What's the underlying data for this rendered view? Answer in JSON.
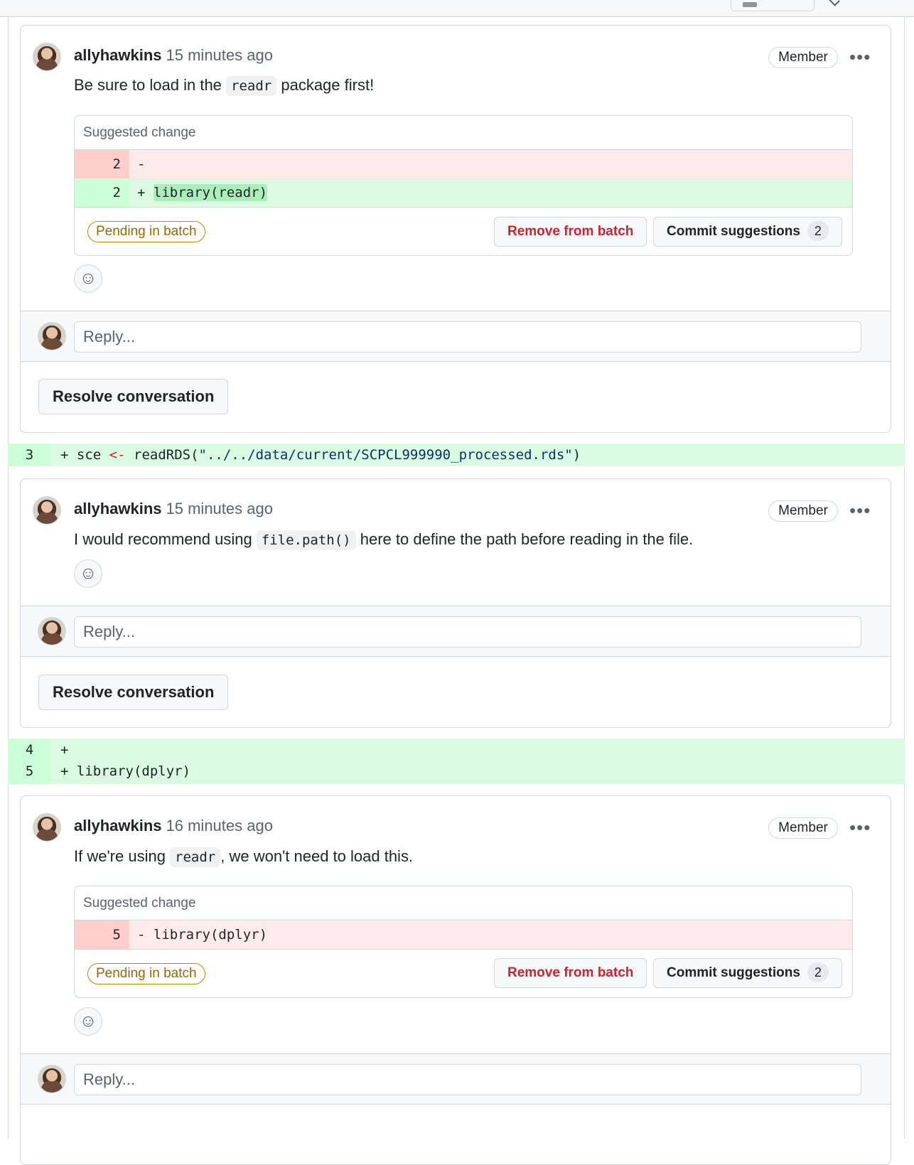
{
  "threads": [
    {
      "author": "allyhawkins",
      "time": "15 minutes ago",
      "role": "Member",
      "body_pre": "Be sure to load in the ",
      "body_code": "readr",
      "body_post": " package first!",
      "suggestion": {
        "header": "Suggested change",
        "rows": [
          {
            "type": "del",
            "line": "2",
            "sign": "-",
            "code": ""
          },
          {
            "type": "add",
            "line": "2",
            "sign": "+",
            "code": "library(readr)"
          }
        ],
        "pending_label": "Pending in batch",
        "remove_label": "Remove from batch",
        "commit_label": "Commit suggestions",
        "commit_count": "2"
      },
      "reply_placeholder": "Reply...",
      "resolve_label": "Resolve conversation"
    },
    {
      "author": "allyhawkins",
      "time": "15 minutes ago",
      "role": "Member",
      "body_pre": "I would recommend using ",
      "body_code": "file.path()",
      "body_post": " here to define the path before reading in the file.",
      "reply_placeholder": "Reply...",
      "resolve_label": "Resolve conversation"
    },
    {
      "author": "allyhawkins",
      "time": "16 minutes ago",
      "role": "Member",
      "body_pre": "If we're using ",
      "body_code": "readr",
      "body_post": ", we won't need to load this.",
      "suggestion": {
        "header": "Suggested change",
        "rows": [
          {
            "type": "del",
            "line": "5",
            "sign": "-",
            "code": "library(dplyr)"
          }
        ],
        "pending_label": "Pending in batch",
        "remove_label": "Remove from batch",
        "commit_label": "Commit suggestions",
        "commit_count": "2"
      },
      "reply_placeholder": "Reply..."
    }
  ],
  "diff": {
    "line3": {
      "num": "3",
      "sign": "+",
      "pre": "sce ",
      "op": "<-",
      "fn": " readRDS(",
      "str": "\"../../data/current/SCPCL999990_processed.rds\"",
      "close": ")"
    },
    "line4": {
      "num": "4",
      "sign": "+",
      "code": ""
    },
    "line5": {
      "num": "5",
      "sign": "+",
      "code": "library(dplyr)"
    }
  }
}
